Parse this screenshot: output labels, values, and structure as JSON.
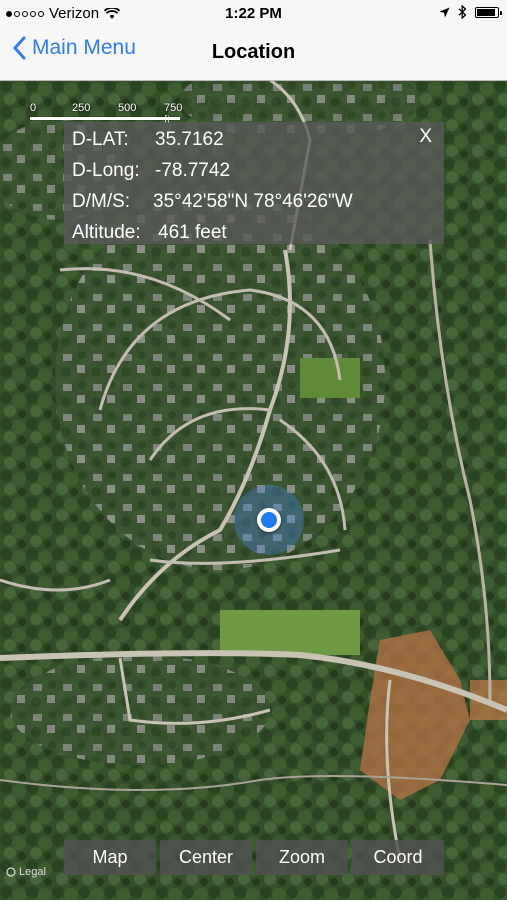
{
  "status_bar": {
    "carrier": "Verizon",
    "time": "1:22 PM",
    "icons": [
      "signal-dots-icon",
      "wifi-icon",
      "location-arrow-icon",
      "bluetooth-icon",
      "battery-icon"
    ]
  },
  "nav": {
    "back_label": "Main Menu",
    "title": "Location",
    "accent_color": "#2f7bf5"
  },
  "map": {
    "scale_labels": [
      "0",
      "250",
      "500",
      "750 ft"
    ],
    "legal_label": "Legal",
    "marker_color": "#1f7cf0"
  },
  "info_panel": {
    "close_label": "X",
    "rows": [
      {
        "label": "D-LAT:",
        "value": "35.7162"
      },
      {
        "label": "D-Long:",
        "value": "-78.7742"
      },
      {
        "label": "D/M/S:",
        "value": "35°42'58\"N 78°46'26\"W"
      },
      {
        "label": "Altitude:",
        "value": "461 feet"
      }
    ]
  },
  "toolbar": {
    "buttons": [
      "Map",
      "Center",
      "Zoom",
      "Coord"
    ]
  }
}
